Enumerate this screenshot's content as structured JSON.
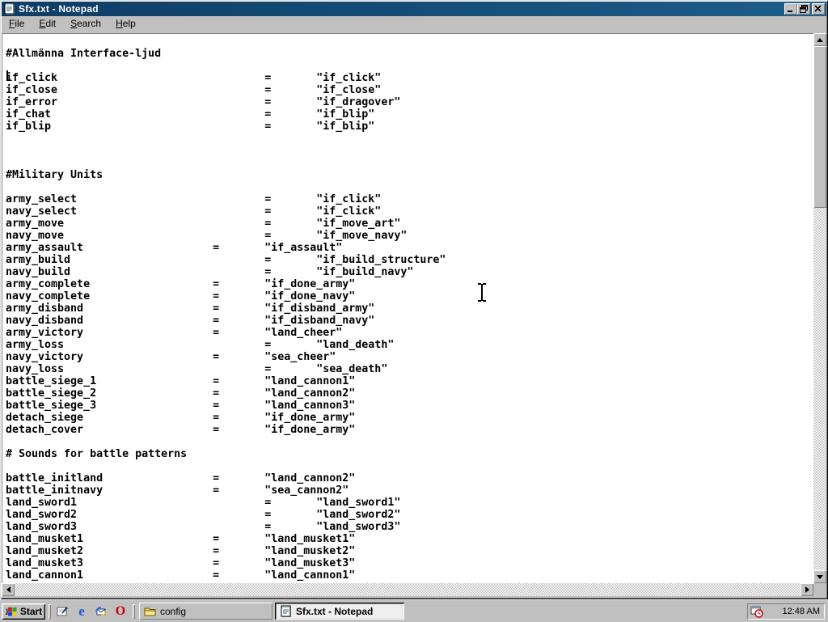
{
  "window": {
    "title": "Sfx.txt - Notepad",
    "icon": "notepad-icon",
    "controls": [
      "minimize",
      "restore",
      "close"
    ]
  },
  "menu": {
    "items": [
      "File",
      "Edit",
      "Search",
      "Help"
    ]
  },
  "editor": {
    "lines": [
      {
        "text": ""
      },
      {
        "text": "#Allmänna Interface-ljud"
      },
      {
        "text": ""
      },
      {
        "key": "if_click",
        "eq": 40,
        "vcol": 48,
        "value": "\"if_click\""
      },
      {
        "key": "if_close",
        "eq": 40,
        "vcol": 48,
        "value": "\"if_close\""
      },
      {
        "key": "if_error",
        "eq": 40,
        "vcol": 48,
        "value": "\"if_dragover\""
      },
      {
        "key": "if_chat",
        "eq": 40,
        "vcol": 48,
        "value": "\"if_blip\""
      },
      {
        "key": "if_blip",
        "eq": 40,
        "vcol": 48,
        "value": "\"if_blip\""
      },
      {
        "text": ""
      },
      {
        "text": ""
      },
      {
        "text": ""
      },
      {
        "text": "#Military Units"
      },
      {
        "text": ""
      },
      {
        "key": "army_select",
        "eq": 40,
        "vcol": 48,
        "value": "\"if_click\""
      },
      {
        "key": "navy_select",
        "eq": 40,
        "vcol": 48,
        "value": "\"if_click\""
      },
      {
        "key": "army_move",
        "eq": 40,
        "vcol": 48,
        "value": "\"if_move_art\""
      },
      {
        "key": "navy_move",
        "eq": 40,
        "vcol": 48,
        "value": "\"if_move_navy\""
      },
      {
        "key": "army_assault",
        "eq": 32,
        "vcol": 40,
        "value": "\"if_assault\""
      },
      {
        "key": "army_build",
        "eq": 40,
        "vcol": 48,
        "value": "\"if_build_structure\""
      },
      {
        "key": "navy_build",
        "eq": 40,
        "vcol": 48,
        "value": "\"if_build_navy\""
      },
      {
        "key": "army_complete",
        "eq": 32,
        "vcol": 40,
        "value": "\"if_done_army\""
      },
      {
        "key": "navy_complete",
        "eq": 32,
        "vcol": 40,
        "value": "\"if_done_navy\""
      },
      {
        "key": "army_disband",
        "eq": 32,
        "vcol": 40,
        "value": "\"if_disband_army\""
      },
      {
        "key": "navy_disband",
        "eq": 32,
        "vcol": 40,
        "value": "\"if_disband_navy\""
      },
      {
        "key": "army_victory",
        "eq": 32,
        "vcol": 40,
        "value": "\"land_cheer\""
      },
      {
        "key": "army_loss",
        "eq": 40,
        "vcol": 48,
        "value": "\"land_death\""
      },
      {
        "key": "navy_victory",
        "eq": 32,
        "vcol": 40,
        "value": "\"sea_cheer\""
      },
      {
        "key": "navy_loss",
        "eq": 40,
        "vcol": 48,
        "value": "\"sea_death\""
      },
      {
        "key": "battle_siege_1",
        "eq": 32,
        "vcol": 40,
        "value": "\"land_cannon1\""
      },
      {
        "key": "battle_siege_2",
        "eq": 32,
        "vcol": 40,
        "value": "\"land_cannon2\""
      },
      {
        "key": "battle_siege_3",
        "eq": 32,
        "vcol": 40,
        "value": "\"land_cannon3\""
      },
      {
        "key": "detach_siege",
        "eq": 32,
        "vcol": 40,
        "value": "\"if_done_army\""
      },
      {
        "key": "detach_cover",
        "eq": 32,
        "vcol": 40,
        "value": "\"if_done_army\""
      },
      {
        "text": ""
      },
      {
        "text": "# Sounds for battle patterns"
      },
      {
        "text": ""
      },
      {
        "key": "battle_initland",
        "eq": 32,
        "vcol": 40,
        "value": "\"land_cannon2\""
      },
      {
        "key": "battle_initnavy",
        "eq": 32,
        "vcol": 40,
        "value": "\"sea_cannon2\""
      },
      {
        "key": "land_sword1",
        "eq": 40,
        "vcol": 48,
        "value": "\"land_sword1\""
      },
      {
        "key": "land_sword2",
        "eq": 40,
        "vcol": 48,
        "value": "\"land_sword2\""
      },
      {
        "key": "land_sword3",
        "eq": 40,
        "vcol": 48,
        "value": "\"land_sword3\""
      },
      {
        "key": "land_musket1",
        "eq": 32,
        "vcol": 40,
        "value": "\"land_musket1\""
      },
      {
        "key": "land_musket2",
        "eq": 32,
        "vcol": 40,
        "value": "\"land_musket2\""
      },
      {
        "key": "land_musket3",
        "eq": 32,
        "vcol": 40,
        "value": "\"land_musket3\""
      },
      {
        "key": "land_cannon1",
        "eq": 32,
        "vcol": 40,
        "value": "\"land_cannon1\""
      }
    ]
  },
  "taskbar": {
    "start_label": "Start",
    "quick_launch": [
      "show-desktop",
      "internet-explorer",
      "outlook-express",
      "opera"
    ],
    "tasks": [
      {
        "label": "config",
        "icon": "folder-icon",
        "active": false
      },
      {
        "label": "Sfx.txt - Notepad",
        "icon": "notepad-icon",
        "active": true
      }
    ],
    "tray": {
      "icons": [
        "task-scheduler"
      ],
      "time": "12:48 AM"
    }
  },
  "colors": {
    "titlebar_start": "#0e3c64",
    "titlebar_end": "#1c5e8a",
    "chrome": "#c0c0c0",
    "editor_bg": "#ffffff",
    "editor_fg": "#000000",
    "title_fg": "#ffffff"
  }
}
